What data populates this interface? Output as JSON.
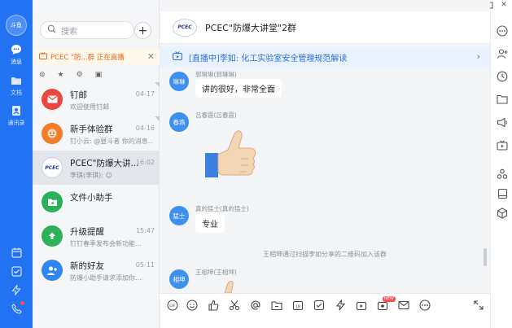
{
  "user": {
    "avatar_text": "斗鱼"
  },
  "rail": {
    "messages_label": "消息",
    "docs_label": "文档",
    "contacts_label": "通讯录"
  },
  "search": {
    "placeholder": "搜索"
  },
  "live_banner": {
    "text": "PCEC \"防...群 正在直播"
  },
  "conversations": [
    {
      "name": "钉邮",
      "time": "04-17",
      "preview": "欢迎使用钉邮",
      "color": "#e8473f"
    },
    {
      "name": "新手体验群",
      "time": "04-16",
      "preview": "钉小云: @昼斗者 你的消息...",
      "color": "#f07c2a"
    },
    {
      "name": "PCEC\"防爆大讲...",
      "time": "16:02",
      "preview": "李琪(李琪): ☺",
      "color": "#ffffff",
      "logo": "PCEC"
    },
    {
      "name": "文件小助手",
      "time": "",
      "preview": "",
      "color": "#2ab15a"
    },
    {
      "name": "升级提醒",
      "time": "15:47",
      "preview": "钉钉春季发布会新功能...",
      "color": "#2ab15a"
    },
    {
      "name": "新的好友",
      "time": "05-11",
      "preview": "防爆小助手请求添加你...",
      "color": "#2f86f0"
    }
  ],
  "chat": {
    "title": "PCEC\"防爆大讲堂\"2群",
    "logo_text": "PCEC",
    "live_strip": "[直播中]李如: 化工实验室安全管理规范解读",
    "messages": [
      {
        "avatar": "琳琳",
        "sender": "郭琳琳(郭琳琳)",
        "text": "讲的很好，非常全面"
      },
      {
        "avatar": "春燕",
        "sender": "吕春霞(吕春霞)",
        "text": ""
      },
      {
        "avatar": "猛士",
        "sender": "真的猛士(真的猛士)",
        "text": "专业"
      },
      {
        "avatar": "相坤",
        "sender": "王相坤(王相坤)",
        "text": ""
      }
    ],
    "system_notice": "王相坤通过扫描李如分享的二维码加入该群",
    "toolbar_badge": "NEW"
  },
  "colors": {
    "brand": "#2173f2",
    "live": "#e06a1a",
    "bubble_avatar": "#3d8ff0"
  }
}
